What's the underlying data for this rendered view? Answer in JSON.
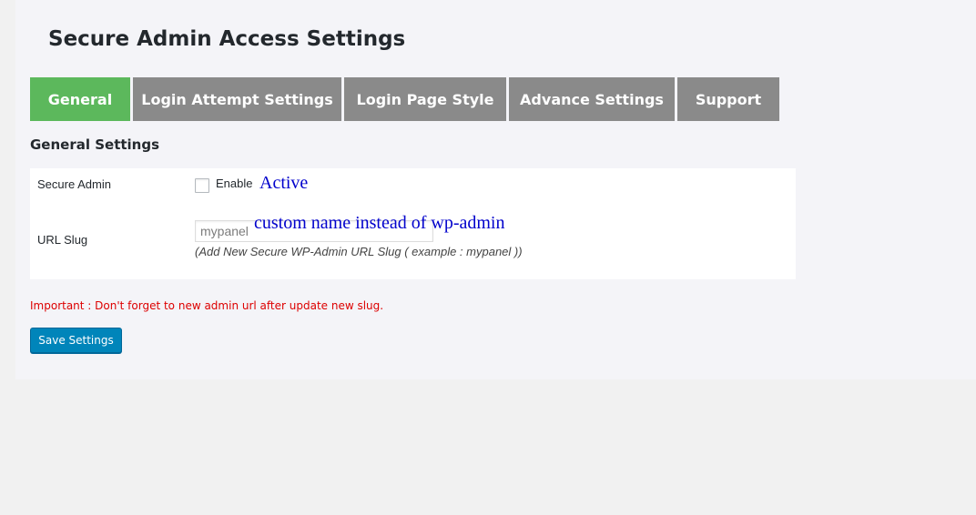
{
  "page": {
    "title": "Secure Admin Access Settings"
  },
  "tabs": [
    {
      "label": "General",
      "active": true
    },
    {
      "label": "Login Attempt Settings",
      "active": false
    },
    {
      "label": "Login Page Style",
      "active": false
    },
    {
      "label": "Advance Settings",
      "active": false
    },
    {
      "label": "Support",
      "active": false
    }
  ],
  "general": {
    "section_title": "General Settings",
    "secure_admin": {
      "label": "Secure Admin",
      "checkbox_label": "Enable",
      "checked": false,
      "annotation": "Active"
    },
    "url_slug": {
      "label": "URL Slug",
      "value": "",
      "placeholder": "mypanel",
      "annotation": "custom name instead of wp-admin",
      "hint": "(Add New Secure WP-Admin URL Slug ( example : mypanel ))"
    },
    "important_note": "Important : Don't forget to new admin url after update new slug.",
    "save_label": "Save Settings"
  },
  "colors": {
    "active_tab": "#5cb85c",
    "inactive_tab": "#8a8a8a",
    "primary_button": "#0085ba",
    "important_text": "#dd0000",
    "annotation_text": "#0000cc"
  }
}
